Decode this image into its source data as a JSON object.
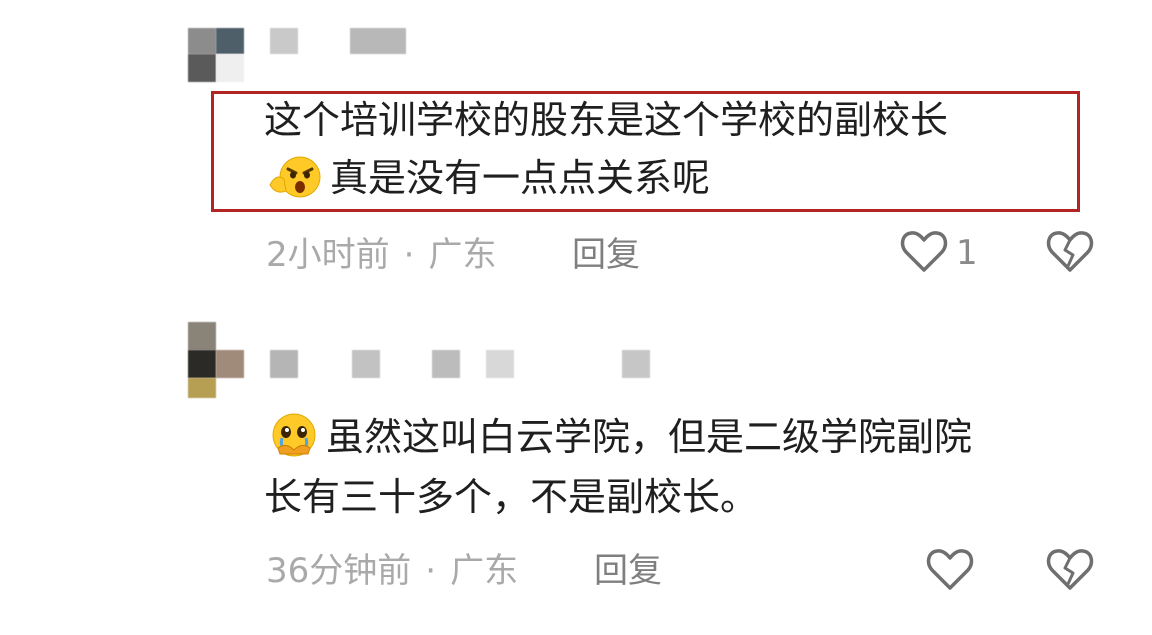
{
  "comments": [
    {
      "line1": "这个培训学校的股东是这个学校的副校长",
      "line2_emoji": "angry-shush-emoji",
      "line2": "真是没有一点点关系呢",
      "time": "2小时前",
      "location": "广东",
      "reply_label": "回复",
      "like_count": "1",
      "highlighted": true
    },
    {
      "line1_emoji": "crying-pleading-emoji",
      "line1": "虽然这叫白云学院，但是二级学院副院",
      "line2": "长有三十多个，不是副校长。",
      "time": "36分钟前",
      "location": "广东",
      "reply_label": "回复",
      "like_count": "",
      "highlighted": false
    }
  ],
  "separator": "·",
  "colors": {
    "highlight_border": "#b32525",
    "meta_text": "#a9a9a9",
    "body_text": "#1f1f1f"
  },
  "icons": [
    "heart-outline-icon",
    "broken-heart-icon"
  ]
}
